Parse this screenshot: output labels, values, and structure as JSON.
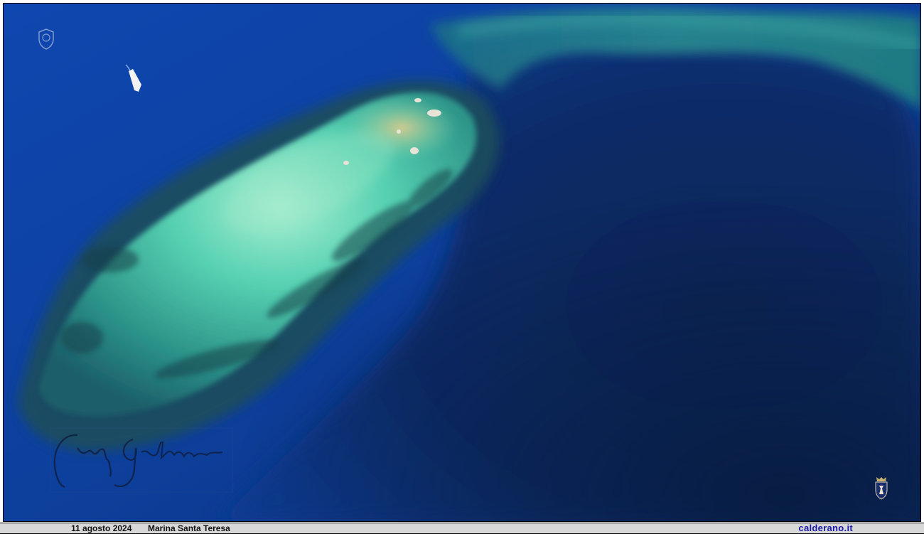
{
  "photo": {
    "subject": "aerial-sea-reef",
    "colors": {
      "deep_sea": "#0a2a6a",
      "open_sea": "#0d3f9a",
      "reef_light": "#5fd6b8",
      "reef_sand": "#c9c79a",
      "reef_dark": "#1b4a52"
    }
  },
  "caption": {
    "date": "11 agosto 2024",
    "place": "Marina Santa Teresa",
    "site": "calderano.it"
  },
  "icons": {
    "top_left": "crest-watermark-icon",
    "bottom_right": "coat-of-arms-icon",
    "signature": "handwritten-signature"
  }
}
